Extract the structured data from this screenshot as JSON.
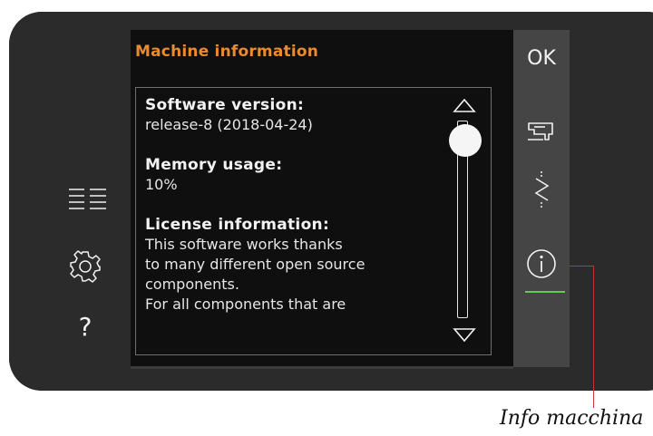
{
  "panel": {
    "title": "Machine information"
  },
  "info": {
    "software_heading": "Software version:",
    "software_value": "release-8 (2018-04-24)",
    "memory_heading": "Memory usage:",
    "memory_value": "10%",
    "license_heading": "License information:",
    "license_text": "This software works thanks\nto many different open source\ncomponents.\nFor all components that are"
  },
  "scroll": {
    "position_fraction": 0.0
  },
  "right_panel": {
    "ok_label": "OK",
    "buttons": [
      {
        "icon": "sewing-machine-icon"
      },
      {
        "icon": "stitch-icon"
      },
      {
        "icon": "info-icon",
        "active": true
      }
    ],
    "active_color": "#5ccf4f"
  },
  "left_panel": {
    "buttons": [
      {
        "icon": "menu-list-icon"
      },
      {
        "icon": "gear-icon"
      },
      {
        "icon": "help-icon",
        "label": "?"
      }
    ]
  },
  "callout": {
    "label": "Info macchina",
    "color": "#c9323a"
  },
  "colors": {
    "title_orange": "#e98b2f",
    "bezel": "#2b2b2b",
    "screen": "#0f0f0f"
  }
}
